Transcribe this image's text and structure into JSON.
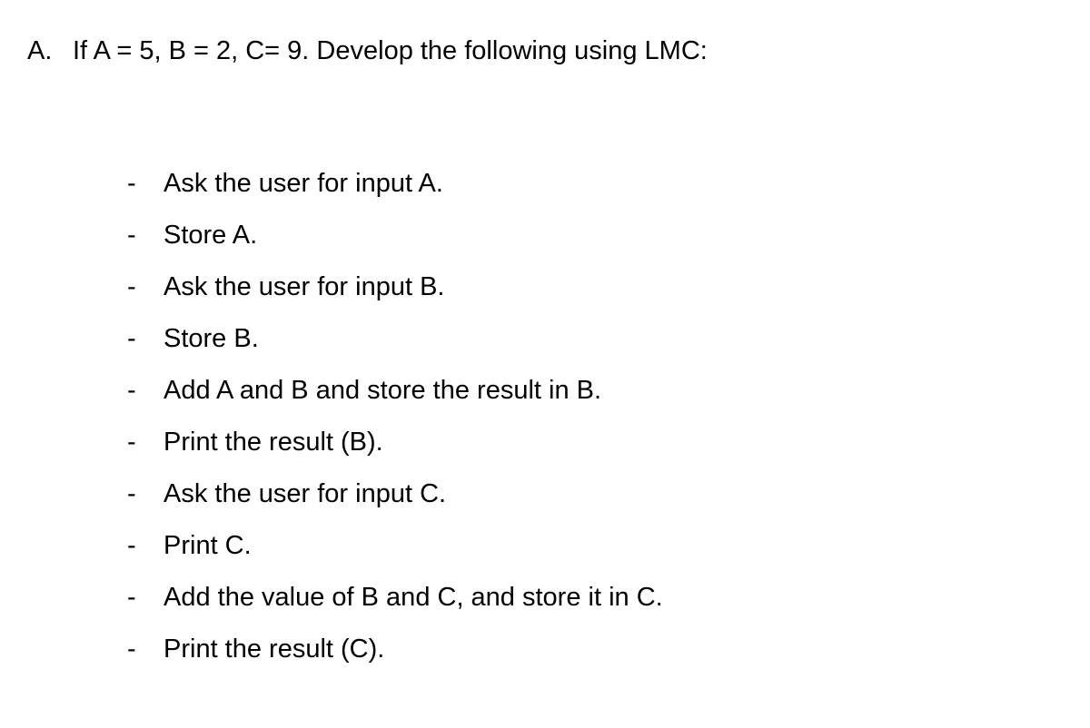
{
  "heading": {
    "marker": "A.",
    "text": "If A = 5, B = 2, C= 9.  Develop the following using LMC:"
  },
  "bullet": "-",
  "items": [
    "Ask the user for input A.",
    "Store A.",
    "Ask the user for input B.",
    "Store B.",
    "Add A and B and store the result in B.",
    "Print the result (B).",
    "Ask the user for input C.",
    "Print C.",
    "Add the value of B and C, and store it in C.",
    "Print the result (C)."
  ]
}
